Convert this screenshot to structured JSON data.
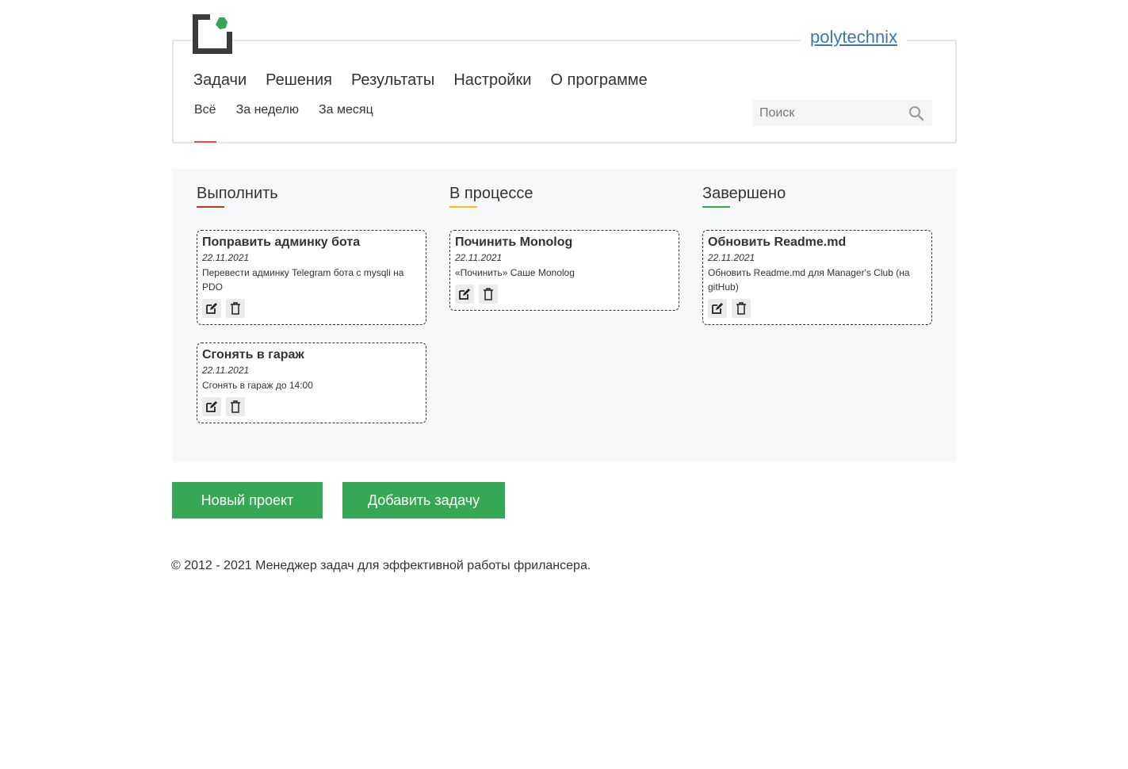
{
  "header": {
    "username": "polytechnix",
    "main_nav": [
      "Задачи",
      "Решения",
      "Результаты",
      "Настройки",
      "О программе"
    ],
    "sub_nav": [
      "Всё",
      "За неделю",
      "За месяц"
    ],
    "search_placeholder": "Поиск"
  },
  "columns": [
    {
      "title": "Выполнить",
      "accent": "#c0392b",
      "cards": [
        {
          "title": "Поправить админку бота",
          "date": "22.11.2021",
          "description": "Перевести админку Telegram бота с mysqli на PDO"
        },
        {
          "title": "Сгонять в гараж",
          "date": "22.11.2021",
          "description": "Сгонять в гараж до 14:00"
        }
      ]
    },
    {
      "title": "В процессе",
      "accent": "#f1c40f",
      "cards": [
        {
          "title": "Починить Monolog",
          "date": "22.11.2021",
          "description": "«Починить» Саше Monolog"
        }
      ]
    },
    {
      "title": "Завершено",
      "accent": "#34a853",
      "cards": [
        {
          "title": "Обновить Readme.md",
          "date": "22.11.2021",
          "description": "Обновить Readme.md для Manager's Club (на gitHub)"
        }
      ]
    }
  ],
  "actions": {
    "new_project": "Новый проект",
    "add_task": "Добавить задачу"
  },
  "footer": {
    "text": "© 2012 - 2021 Менеджер задач для эффективной работы фрилансера."
  },
  "colors": {
    "primary_green": "#34a853",
    "link_blue": "#3a78b0",
    "active_underline": "#d9534f"
  }
}
